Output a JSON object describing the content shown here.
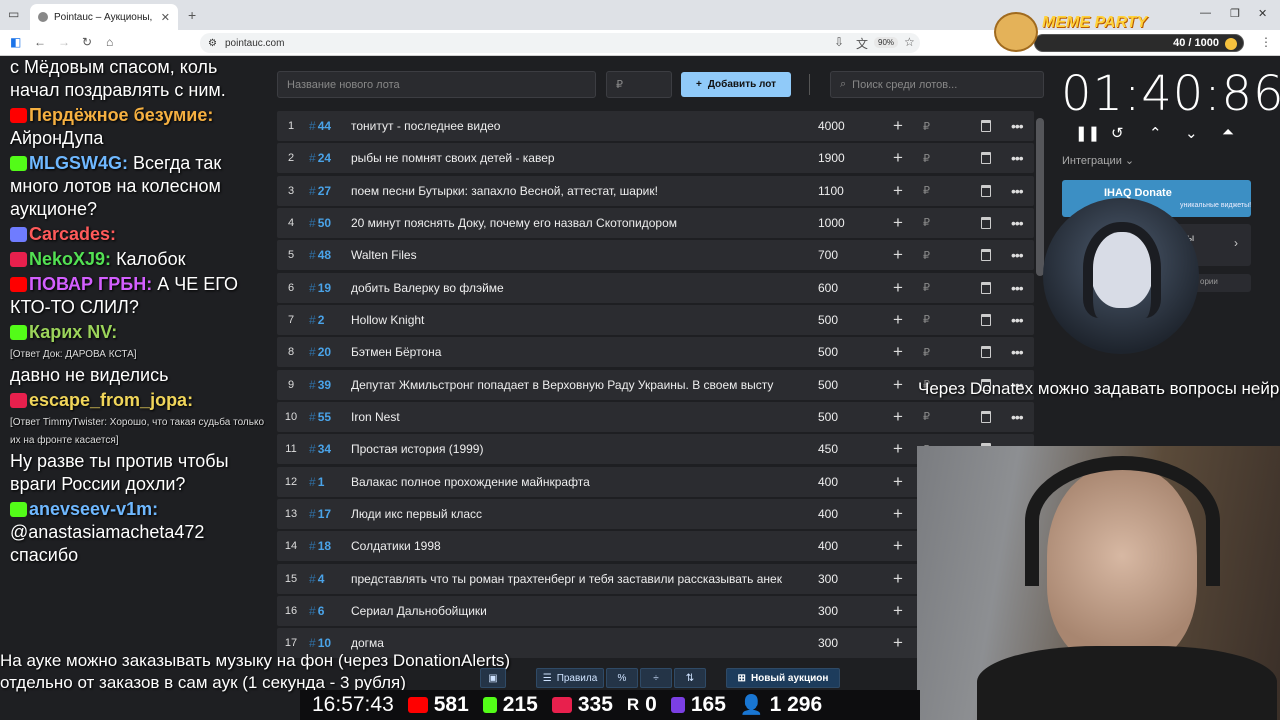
{
  "browser": {
    "tab_title": "Pointauc – Аукционы, лотереи",
    "url": "pointauc.com",
    "zoom": "90%"
  },
  "meme_party": {
    "title": "MEME PARTY",
    "count": "40 / 1000"
  },
  "chat": [
    {
      "nick": "",
      "text": "с Мёдовым спасом, коль начал поздравлять с ним.",
      "color": "#ffffff"
    },
    {
      "nick": "Пердёжное безумие:",
      "text": "АйронДупа",
      "color": "#f5b041"
    },
    {
      "nick": "MLGSW4G:",
      "text": "Всегда так много лотов на колесном аукционе?",
      "color": "#6fb8ff"
    },
    {
      "nick": "Carcades:",
      "text": "",
      "color": "#ff5a5a"
    },
    {
      "nick": "NekoXJ9:",
      "text": "Калобок",
      "color": "#53e053"
    },
    {
      "nick": "ПОВАР ГРБН:",
      "text": "А ЧЕ ЕГО КТО-ТО СЛИЛ?",
      "color": "#d35fff"
    },
    {
      "nick": "Карих NV:",
      "text": "",
      "color": "#9bd35a",
      "reply": "[Ответ Док: ДАРОВА КСТА]"
    },
    {
      "nick": "",
      "text": "давно не виделись",
      "color": "#ffffff"
    },
    {
      "nick": "escape_from_jopa:",
      "text": "",
      "color": "#f0d55a",
      "reply": "[Ответ TimmyTwister: Хорошо, что такая судьба только их на фронте касается]"
    },
    {
      "nick": "",
      "text": "Ну разве ты против  чтобы враги России дохли?",
      "color": "#ffffff"
    },
    {
      "nick": "anevseev-v1m:",
      "text": "@anastasiamacheta472 спасибо",
      "color": "#6fb8ff"
    }
  ],
  "form": {
    "new_lot_placeholder": "Название нового лота",
    "amount_placeholder": "₽",
    "add_button": "Добавить лот",
    "search_placeholder": "Поиск среди лотов..."
  },
  "lots": [
    {
      "n": "1",
      "id": "44",
      "name": "тонитут - последнее видео",
      "amount": "4000"
    },
    {
      "n": "2",
      "id": "24",
      "name": "рыбы не помнят своих детей - кавер",
      "amount": "1900"
    },
    {
      "n": "3",
      "id": "27",
      "name": "поем песни Бутырки: запахло Весной, аттестат, шарик!",
      "amount": "1100"
    },
    {
      "n": "4",
      "id": "50",
      "name": "20 минут пояснять Доку, почему его назвал Скотопидором",
      "amount": "1000"
    },
    {
      "n": "5",
      "id": "48",
      "name": "Walten Files",
      "amount": "700"
    },
    {
      "n": "6",
      "id": "19",
      "name": "добить Валерку во флэйме",
      "amount": "600"
    },
    {
      "n": "7",
      "id": "2",
      "name": "Hollow Knight",
      "amount": "500"
    },
    {
      "n": "8",
      "id": "20",
      "name": "Бэтмен Бёртона",
      "amount": "500"
    },
    {
      "n": "9",
      "id": "39",
      "name": "Депутат Жмильстронг попадает в Верховную Раду Украины. В своем высту",
      "amount": "500"
    },
    {
      "n": "10",
      "id": "55",
      "name": "Iron Nest",
      "amount": "500"
    },
    {
      "n": "11",
      "id": "34",
      "name": "Простая история (1999)",
      "amount": "450"
    },
    {
      "n": "12",
      "id": "1",
      "name": "Валакас полное прохождение майнкрафта",
      "amount": "400"
    },
    {
      "n": "13",
      "id": "17",
      "name": "Люди икс первый класс",
      "amount": "400"
    },
    {
      "n": "14",
      "id": "18",
      "name": "Солдатики 1998",
      "amount": "400"
    },
    {
      "n": "15",
      "id": "4",
      "name": "представлять что ты роман трахтенберг и тебя заставили рассказывать анек",
      "amount": "300"
    },
    {
      "n": "16",
      "id": "6",
      "name": "Сериал Дальнобойщики",
      "amount": "300"
    },
    {
      "n": "17",
      "id": "10",
      "name": "догма",
      "amount": "300"
    }
  ],
  "currency": "₽",
  "timer": {
    "value": "01:40:86"
  },
  "integrations": {
    "label": "Интеграции",
    "donate_title": "IHAQ Donate",
    "donate_sub": "уникальные виджеты!",
    "card2_text": "сы",
    "card3_text": "ории"
  },
  "overlay": {
    "donatex": "Через Donatex можно задавать вопросы нейросети",
    "music_line1": "На ауке можно заказывать музыку на фон (через DonationAlerts)",
    "music_line2": "отдельно от заказов в сам аук (1 секунда - 3 рубля)"
  },
  "bottom_toolbar": {
    "rules": "Правила",
    "percent": "%",
    "new_auction": "Новый аукцион"
  },
  "stats": {
    "time": "16:57:43",
    "youtube": "581",
    "kick": "215",
    "vk": "335",
    "rutube": "0",
    "trovo": "165",
    "total": "1 296"
  },
  "colors": {
    "accent": "#90caf9",
    "id": "#4aa3e8",
    "row": "#2b2c30",
    "bg": "#1e1f22"
  }
}
